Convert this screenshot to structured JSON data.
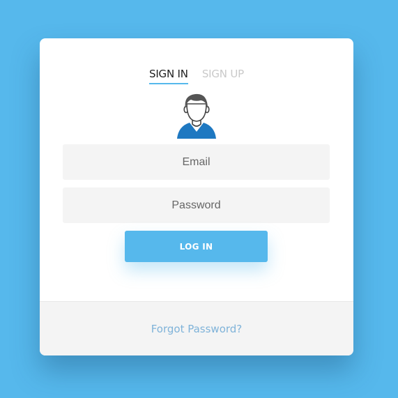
{
  "tabs": [
    {
      "label": "SIGN IN",
      "active": true
    },
    {
      "label": "SIGN UP",
      "active": false
    }
  ],
  "avatar": {
    "icon": "user-avatar-icon"
  },
  "form": {
    "email": {
      "placeholder": "Email",
      "value": ""
    },
    "password": {
      "placeholder": "Password",
      "value": ""
    },
    "login_label": "LOG IN"
  },
  "footer": {
    "forgot_label": "Forgot Password?"
  },
  "colors": {
    "background": "#56b8ec",
    "accent": "#56b8ec",
    "card": "#ffffff",
    "field_bg": "#f4f4f4",
    "footer_bg": "#f4f4f4",
    "link": "#7fb3d9"
  }
}
